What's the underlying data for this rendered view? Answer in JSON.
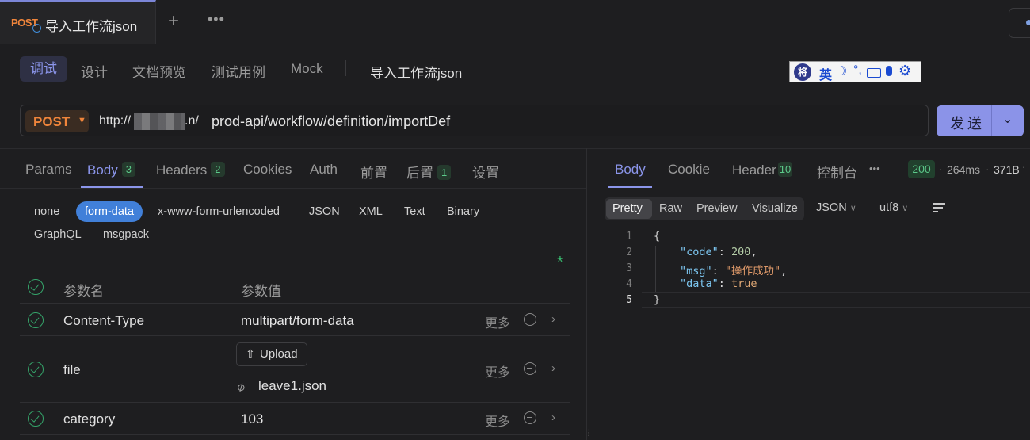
{
  "tab": {
    "method": "POST",
    "title": "导入工作流json",
    "add_icon": "plus-icon",
    "more_icon": "ellipsis-icon"
  },
  "modes": {
    "items": [
      "调试",
      "设计",
      "文档预览",
      "测试用例",
      "Mock"
    ],
    "active": "调试",
    "title": "导入工作流json"
  },
  "ime": {
    "lang": "英",
    "moon": "☽",
    "punct": "°,"
  },
  "request": {
    "method": "POST",
    "url_host": "http://",
    "url_tld": ".n/",
    "url_path": "prod-api/workflow/definition/importDef",
    "send_label": "发送"
  },
  "request_tabs": [
    {
      "label": "Params"
    },
    {
      "label": "Body",
      "count": "3",
      "active": true
    },
    {
      "label": "Headers",
      "count": "2"
    },
    {
      "label": "Cookies"
    },
    {
      "label": "Auth"
    },
    {
      "label": "前置"
    },
    {
      "label": "后置",
      "count": "1"
    },
    {
      "label": "设置"
    }
  ],
  "body_types": [
    "none",
    "form-data",
    "x-www-form-urlencoded",
    "JSON",
    "XML",
    "Text",
    "Binary",
    "GraphQL",
    "msgpack"
  ],
  "body_type_active": "form-data",
  "params": {
    "header_name": "参数名",
    "header_value": "参数值",
    "more_label": "更多",
    "rows": [
      {
        "name": "Content-Type",
        "value": "multipart/form-data"
      },
      {
        "name": "file",
        "upload_label": "Upload",
        "file": "leave1.json"
      },
      {
        "name": "category",
        "value": "103"
      }
    ]
  },
  "response": {
    "tabs": [
      {
        "label": "Body",
        "active": true
      },
      {
        "label": "Cookie"
      },
      {
        "label": "Header",
        "count": "10"
      },
      {
        "label": "控制台"
      }
    ],
    "more": "•••",
    "status": "200",
    "time": "264ms",
    "size": "371B",
    "views": [
      "Pretty",
      "Raw",
      "Preview",
      "Visualize"
    ],
    "view_active": "Pretty",
    "format": "JSON",
    "encoding": "utf8",
    "line_numbers": [
      "1",
      "2",
      "3",
      "4",
      "5"
    ],
    "json": {
      "code": 200,
      "msg": "操作成功",
      "data": true
    },
    "code_tokens": {
      "open": "{",
      "k_code": "\"code\"",
      "v_code": "200",
      "k_msg": "\"msg\"",
      "v_msg": "\"操作成功\"",
      "k_data": "\"data\"",
      "v_data": "true",
      "close": "}"
    }
  },
  "colors": {
    "accent": "#8b95ea",
    "method": "#f0853b",
    "success": "#5cc98a",
    "form_data_pill": "#4180d9"
  }
}
